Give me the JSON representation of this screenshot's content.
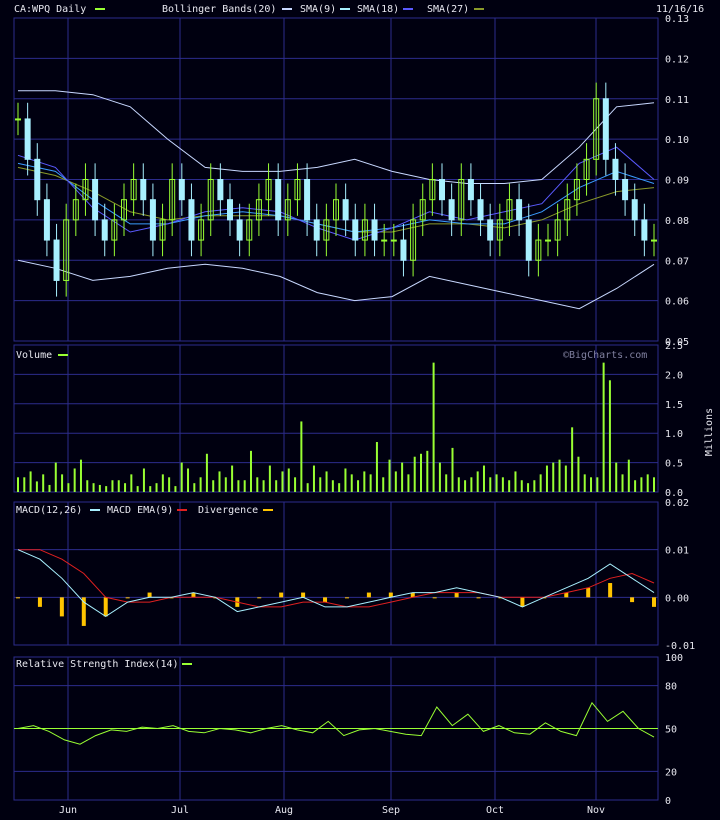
{
  "header": {
    "symbol_label": "CA:WPQ Daily",
    "date": "11/16/16",
    "bollinger_label": "Bollinger Bands(20)",
    "sma9_label": "SMA(9)",
    "sma18_label": "SMA(18)",
    "sma27_label": "SMA(27)"
  },
  "colors": {
    "background": "#000010",
    "grid": "#2c2c8c",
    "candle_up": "#99ff33",
    "candle_down": "#a8f0ff",
    "bollinger": "#c8d8ff",
    "sma9": "#a8f0ff",
    "sma18": "#5a5aff",
    "sma27": "#3a9cff",
    "olive": "#8a9a2a",
    "volume": "#99ff33",
    "macd_ema": "#e02020",
    "divergence": "#ffc400",
    "rsi": "#99ff33"
  },
  "watermark": "©BigCharts.com",
  "chart_data": [
    {
      "type": "candlestick",
      "title": "CA:WPQ Daily",
      "ylim": [
        0.05,
        0.13
      ],
      "y_ticks": [
        "0.13",
        "0.12",
        "0.11",
        "0.10",
        "0.09",
        "0.08",
        "0.07",
        "0.06",
        "0.05"
      ],
      "x_ticks": [
        "Jun",
        "Jul",
        "Aug",
        "Sep",
        "Oct",
        "Nov"
      ],
      "bollinger_upper": [
        0.112,
        0.112,
        0.111,
        0.108,
        0.1,
        0.093,
        0.092,
        0.092,
        0.093,
        0.095,
        0.092,
        0.09,
        0.089,
        0.089,
        0.09,
        0.098,
        0.108,
        0.109
      ],
      "bollinger_lower": [
        0.07,
        0.068,
        0.065,
        0.066,
        0.068,
        0.069,
        0.068,
        0.066,
        0.062,
        0.06,
        0.061,
        0.066,
        0.064,
        0.062,
        0.06,
        0.058,
        0.063,
        0.069
      ],
      "sma9": [
        0.096,
        0.093,
        0.083,
        0.077,
        0.079,
        0.082,
        0.083,
        0.082,
        0.078,
        0.075,
        0.078,
        0.082,
        0.08,
        0.082,
        0.084,
        0.094,
        0.098,
        0.09
      ],
      "sma18": [
        0.094,
        0.092,
        0.085,
        0.079,
        0.079,
        0.081,
        0.082,
        0.081,
        0.079,
        0.077,
        0.078,
        0.08,
        0.079,
        0.079,
        0.082,
        0.088,
        0.092,
        0.089
      ],
      "sma27": [
        0.093,
        0.091,
        0.087,
        0.082,
        0.08,
        0.081,
        0.081,
        0.081,
        0.079,
        0.077,
        0.077,
        0.079,
        0.079,
        0.078,
        0.08,
        0.084,
        0.087,
        0.088
      ],
      "closes": [
        0.105,
        0.095,
        0.085,
        0.075,
        0.065,
        0.08,
        0.085,
        0.09,
        0.08,
        0.075,
        0.08,
        0.085,
        0.09,
        0.085,
        0.075,
        0.08,
        0.09,
        0.085,
        0.075,
        0.08,
        0.09,
        0.085,
        0.08,
        0.075,
        0.08,
        0.085,
        0.09,
        0.08,
        0.085,
        0.09,
        0.08,
        0.075,
        0.08,
        0.085,
        0.08,
        0.075,
        0.08,
        0.075,
        0.075,
        0.075,
        0.07,
        0.08,
        0.085,
        0.09,
        0.085,
        0.08,
        0.09,
        0.085,
        0.08,
        0.075,
        0.08,
        0.085,
        0.08,
        0.07,
        0.075,
        0.075,
        0.08,
        0.085,
        0.09,
        0.095,
        0.11,
        0.095,
        0.09,
        0.085,
        0.08,
        0.075,
        0.075
      ]
    },
    {
      "type": "bar",
      "title": "Volume",
      "ylabel": "Millions",
      "ylim": [
        0,
        2.5
      ],
      "y_ticks": [
        "2.5",
        "2.0",
        "1.5",
        "1.0",
        "0.5",
        "0.0"
      ],
      "values": [
        0.25,
        0.25,
        0.35,
        0.18,
        0.3,
        0.12,
        0.5,
        0.3,
        0.15,
        0.4,
        0.55,
        0.2,
        0.15,
        0.12,
        0.1,
        0.2,
        0.2,
        0.15,
        0.3,
        0.1,
        0.4,
        0.1,
        0.15,
        0.3,
        0.25,
        0.1,
        0.5,
        0.4,
        0.15,
        0.25,
        0.65,
        0.2,
        0.35,
        0.25,
        0.45,
        0.2,
        0.2,
        0.7,
        0.25,
        0.2,
        0.45,
        0.2,
        0.35,
        0.4,
        0.25,
        1.2,
        0.15,
        0.45,
        0.25,
        0.35,
        0.2,
        0.15,
        0.4,
        0.3,
        0.2,
        0.35,
        0.3,
        0.85,
        0.25,
        0.55,
        0.35,
        0.5,
        0.3,
        0.6,
        0.65,
        0.7,
        2.2,
        0.5,
        0.3,
        0.75,
        0.25,
        0.2,
        0.25,
        0.35,
        0.45,
        0.25,
        0.3,
        0.25,
        0.2,
        0.35,
        0.2,
        0.15,
        0.2,
        0.3,
        0.45,
        0.5,
        0.55,
        0.45,
        1.1,
        0.6,
        0.3,
        0.25,
        0.25,
        2.2,
        1.9,
        0.5,
        0.3,
        0.55,
        0.2,
        0.25,
        0.3,
        0.25
      ]
    },
    {
      "type": "line",
      "title": "MACD(12,26)",
      "series": [
        {
          "name": "MACD(12,26)",
          "values": [
            0.01,
            0.008,
            0.004,
            -0.001,
            -0.004,
            -0.001,
            0.0,
            0.0,
            0.001,
            0.0,
            -0.003,
            -0.002,
            -0.001,
            0.0,
            -0.002,
            -0.002,
            -0.001,
            0.0,
            0.001,
            0.001,
            0.002,
            0.001,
            0.0,
            -0.002,
            0.0,
            0.002,
            0.004,
            0.007,
            0.004,
            0.001
          ]
        },
        {
          "name": "MACD EMA(9)",
          "values": [
            0.01,
            0.01,
            0.008,
            0.005,
            0.0,
            -0.001,
            -0.001,
            0.0,
            0.0,
            0.0,
            -0.001,
            -0.002,
            -0.002,
            -0.001,
            -0.001,
            -0.002,
            -0.002,
            -0.001,
            0.0,
            0.001,
            0.001,
            0.001,
            0.0,
            0.0,
            0.0,
            0.001,
            0.002,
            0.004,
            0.005,
            0.003
          ]
        },
        {
          "name": "Divergence",
          "values": [
            0.0,
            -0.002,
            -0.004,
            -0.006,
            -0.004,
            0.0,
            0.001,
            0.0,
            0.001,
            0.0,
            -0.002,
            0.0,
            0.001,
            0.001,
            -0.001,
            0.0,
            0.001,
            0.001,
            0.001,
            0.0,
            0.001,
            0.0,
            0.0,
            -0.002,
            0.0,
            0.001,
            0.002,
            0.003,
            -0.001,
            -0.002
          ]
        }
      ],
      "ylim": [
        -0.01,
        0.02
      ],
      "y_ticks": [
        "0.02",
        "0.01",
        "0.00",
        "-0.01"
      ]
    },
    {
      "type": "line",
      "title": "Relative Strength Index(14)",
      "series": [
        {
          "name": "Relative Strength Index(14)",
          "values": [
            50,
            52,
            48,
            42,
            39,
            45,
            49,
            48,
            51,
            50,
            52,
            48,
            47,
            50,
            49,
            47,
            50,
            52,
            49,
            47,
            55,
            45,
            49,
            50,
            48,
            46,
            45,
            65,
            52,
            60,
            48,
            52,
            47,
            46,
            54,
            48,
            45,
            68,
            55,
            62,
            50,
            44
          ]
        }
      ],
      "ylim": [
        0,
        100
      ],
      "y_ticks": [
        "100",
        "80",
        "50",
        "20",
        "0"
      ],
      "reference_line": 50
    }
  ]
}
